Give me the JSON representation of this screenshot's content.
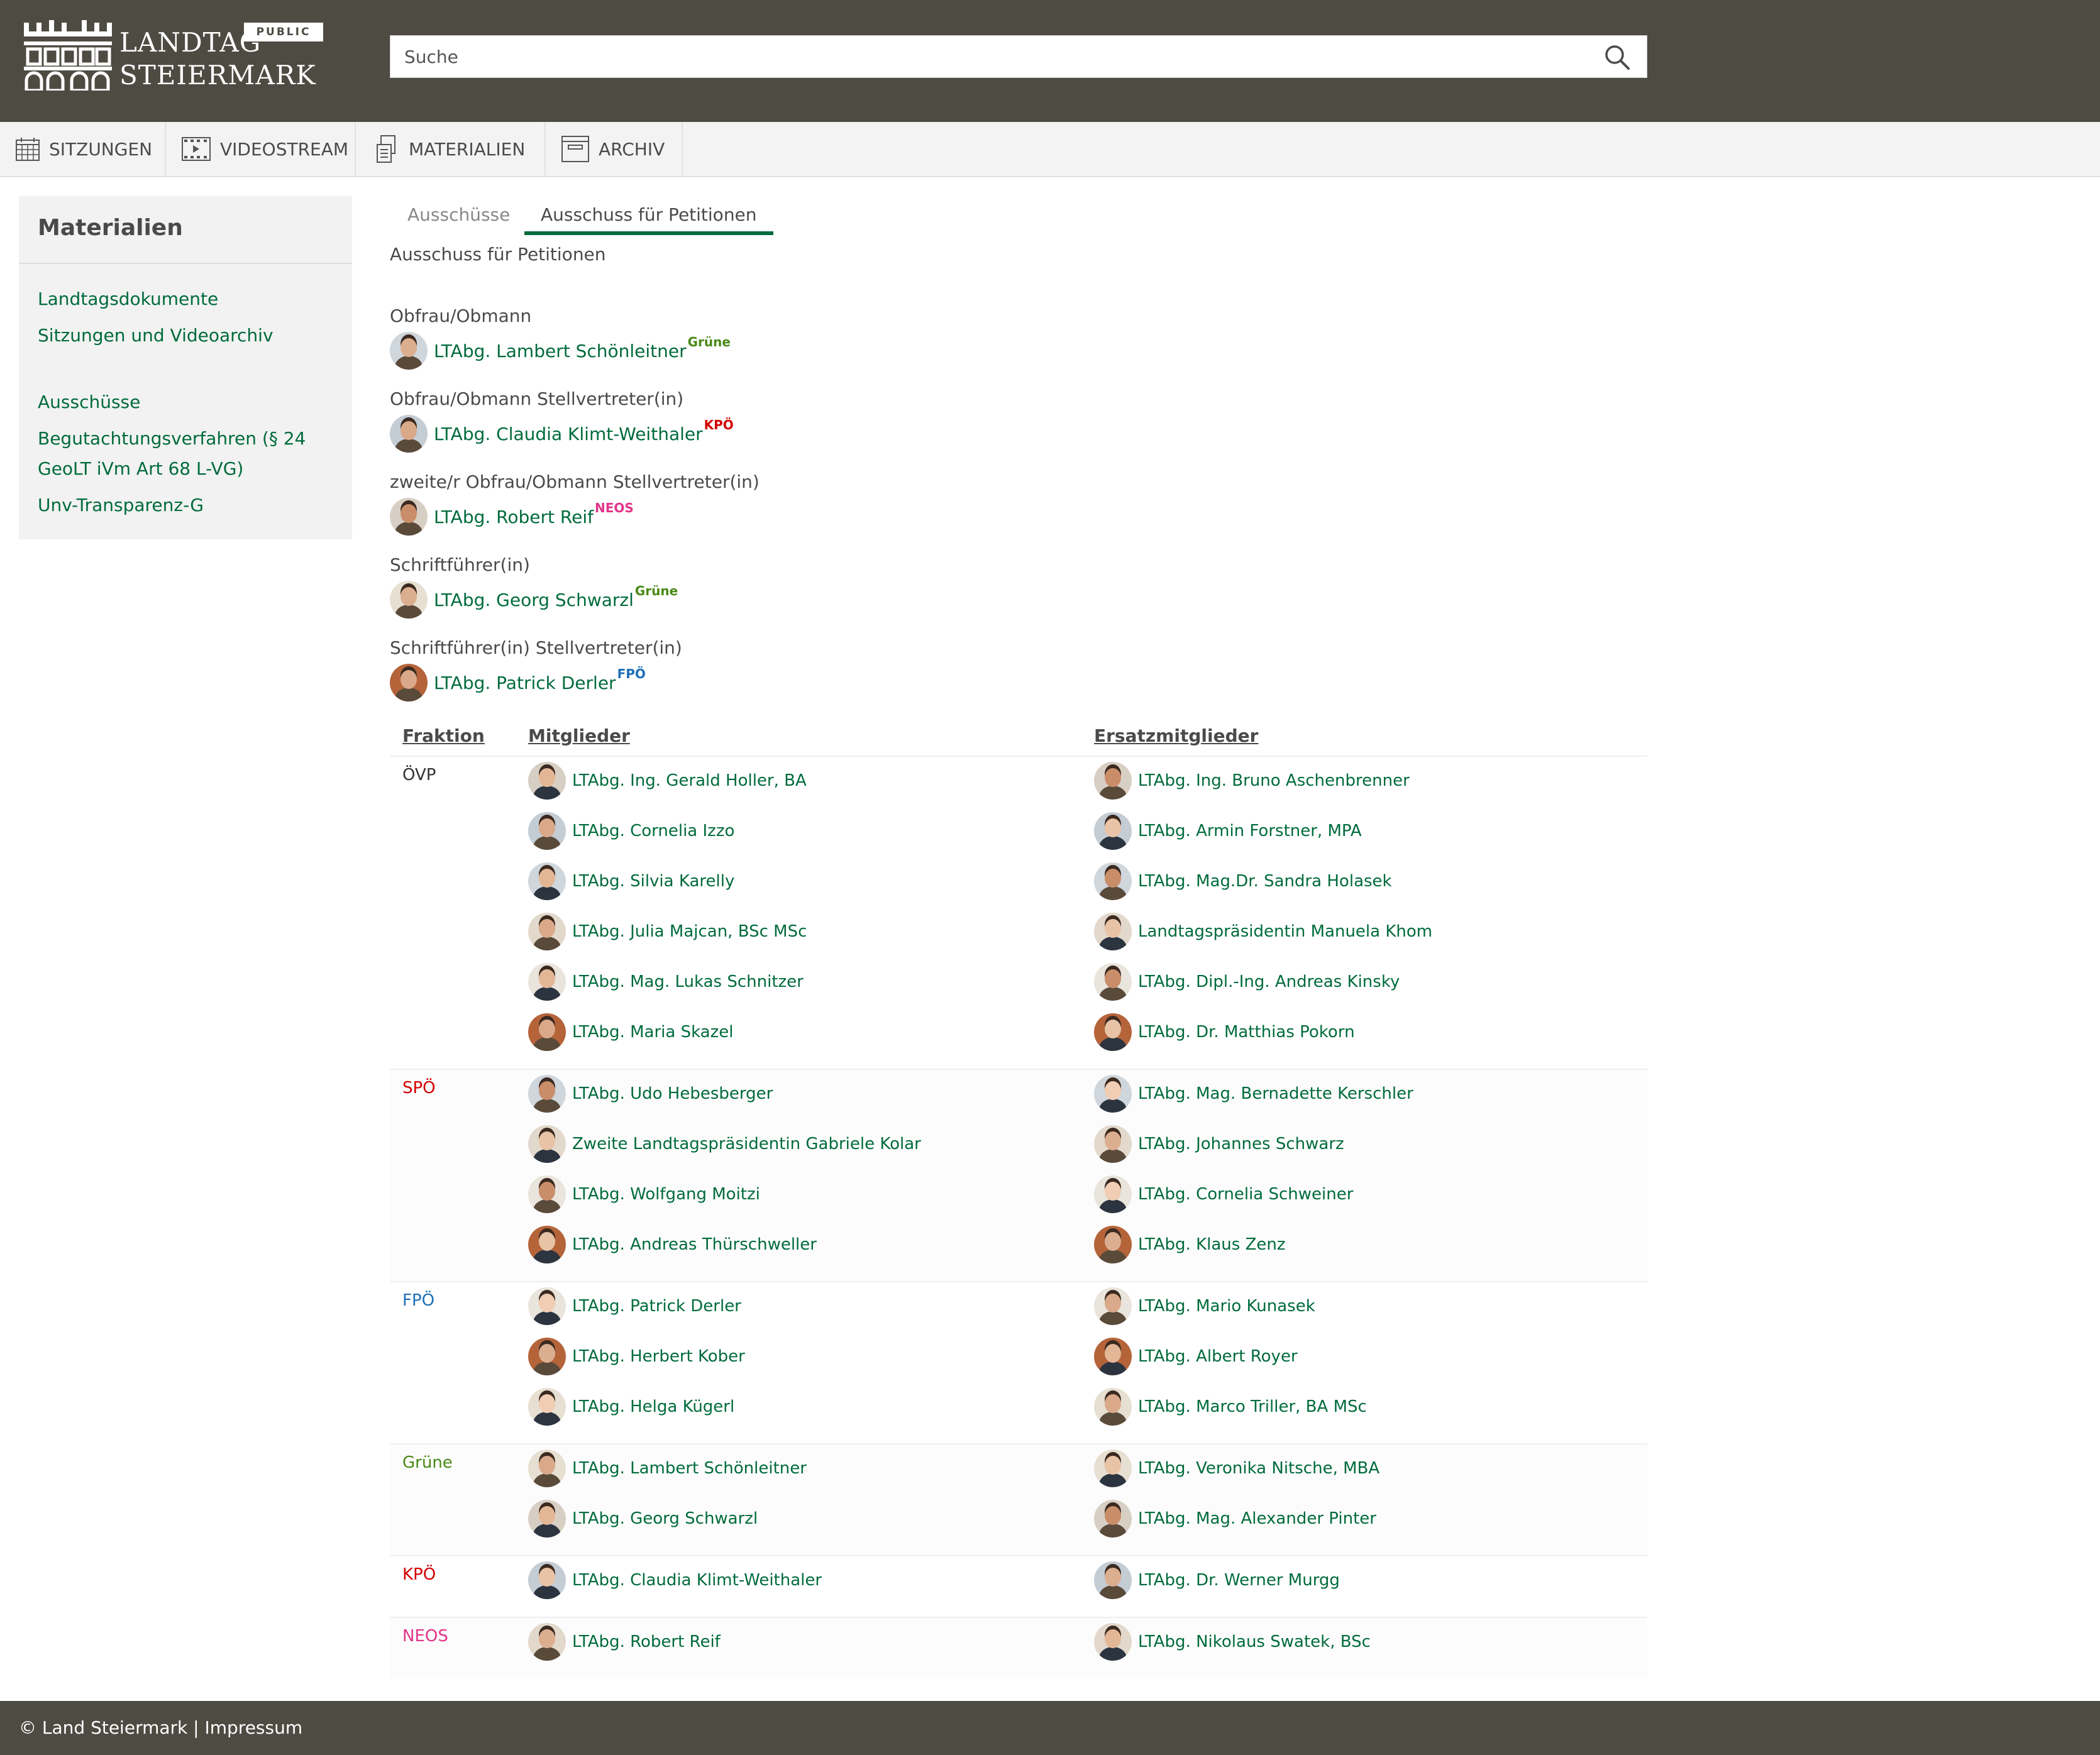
{
  "colors": {
    "header_bg": "#4d4b42",
    "link_green": "#006b3c",
    "gruene": "#4a8a17",
    "kpoe": "#d40000",
    "neos": "#e2348a",
    "fpoe": "#1f6fb8",
    "spoe": "#d40000",
    "oevp": "#333333"
  },
  "logo": {
    "line1": "LANDTAG",
    "line2": "STEIERMARK",
    "badge": "PUBLIC"
  },
  "search": {
    "placeholder": "Suche"
  },
  "nav": [
    {
      "label": "SITZUNGEN",
      "icon": "calendar-icon"
    },
    {
      "label": "VIDEOSTREAM",
      "icon": "video-icon"
    },
    {
      "label": "MATERIALIEN",
      "icon": "documents-icon"
    },
    {
      "label": "ARCHIV",
      "icon": "archive-icon"
    }
  ],
  "sidebar": {
    "title": "Materialien",
    "links": [
      "Landtagsdokumente",
      "Sitzungen und Videoarchiv",
      "Ausschüsse",
      "Begutachtungsverfahren (§ 24",
      "GeoLT iVm Art 68 L-VG)",
      "Unv-Transparenz-G"
    ]
  },
  "tabs": {
    "inactive": "Ausschüsse",
    "active": "Ausschuss für Petitionen"
  },
  "subtitle": "Ausschuss für Petitionen",
  "roles": [
    {
      "label": "Obfrau/Obmann",
      "name": "LTAbg. Lambert Schönleitner",
      "party": "Grüne"
    },
    {
      "label": "Obfrau/Obmann Stellvertreter(in)",
      "name": "LTAbg. Claudia Klimt-Weithaler",
      "party": "KPÖ"
    },
    {
      "label": "zweite/r Obfrau/Obmann Stellvertreter(in)",
      "name": "LTAbg. Robert Reif",
      "party": "NEOS"
    },
    {
      "label": "Schriftführer(in)",
      "name": "LTAbg. Georg Schwarzl",
      "party": "Grüne"
    },
    {
      "label": "Schriftführer(in) Stellvertreter(in)",
      "name": "LTAbg. Patrick Derler",
      "party": "FPÖ"
    }
  ],
  "table": {
    "headers": {
      "faction": "Fraktion",
      "members": "Mitglieder",
      "substitutes": "Ersatzmitglieder"
    },
    "groups": [
      {
        "faction": "ÖVP",
        "members": [
          "LTAbg. Ing. Gerald Holler, BA",
          "LTAbg. Cornelia Izzo",
          "LTAbg. Silvia Karelly",
          "LTAbg. Julia Majcan, BSc MSc",
          "LTAbg. Mag. Lukas Schnitzer",
          "LTAbg. Maria Skazel"
        ],
        "substitutes": [
          "LTAbg. Ing. Bruno Aschenbrenner",
          "LTAbg. Armin Forstner, MPA",
          "LTAbg. Mag.Dr. Sandra Holasek",
          "Landtagspräsidentin Manuela Khom",
          "LTAbg. Dipl.-Ing. Andreas Kinsky",
          "LTAbg. Dr. Matthias Pokorn"
        ]
      },
      {
        "faction": "SPÖ",
        "members": [
          "LTAbg. Udo Hebesberger",
          "Zweite Landtagspräsidentin Gabriele Kolar",
          "LTAbg. Wolfgang Moitzi",
          "LTAbg. Andreas Thürschweller"
        ],
        "substitutes": [
          "LTAbg. Mag. Bernadette Kerschler",
          "LTAbg. Johannes Schwarz",
          "LTAbg. Cornelia Schweiner",
          "LTAbg. Klaus Zenz"
        ]
      },
      {
        "faction": "FPÖ",
        "members": [
          "LTAbg. Patrick Derler",
          "LTAbg. Herbert Kober",
          "LTAbg. Helga Kügerl"
        ],
        "substitutes": [
          "LTAbg. Mario Kunasek",
          "LTAbg. Albert Royer",
          "LTAbg. Marco Triller, BA MSc"
        ]
      },
      {
        "faction": "Grüne",
        "members": [
          "LTAbg. Lambert Schönleitner",
          "LTAbg. Georg Schwarzl"
        ],
        "substitutes": [
          "LTAbg. Veronika Nitsche, MBA",
          "LTAbg. Mag. Alexander Pinter"
        ]
      },
      {
        "faction": "KPÖ",
        "members": [
          "LTAbg. Claudia Klimt-Weithaler"
        ],
        "substitutes": [
          "LTAbg. Dr. Werner Murgg"
        ]
      },
      {
        "faction": "NEOS",
        "members": [
          "LTAbg. Robert Reif"
        ],
        "substitutes": [
          "LTAbg. Nikolaus Swatek, BSc"
        ]
      }
    ]
  },
  "footer": {
    "copyright": "© Land Steiermark",
    "separator": "|",
    "impressum": "Impressum"
  }
}
